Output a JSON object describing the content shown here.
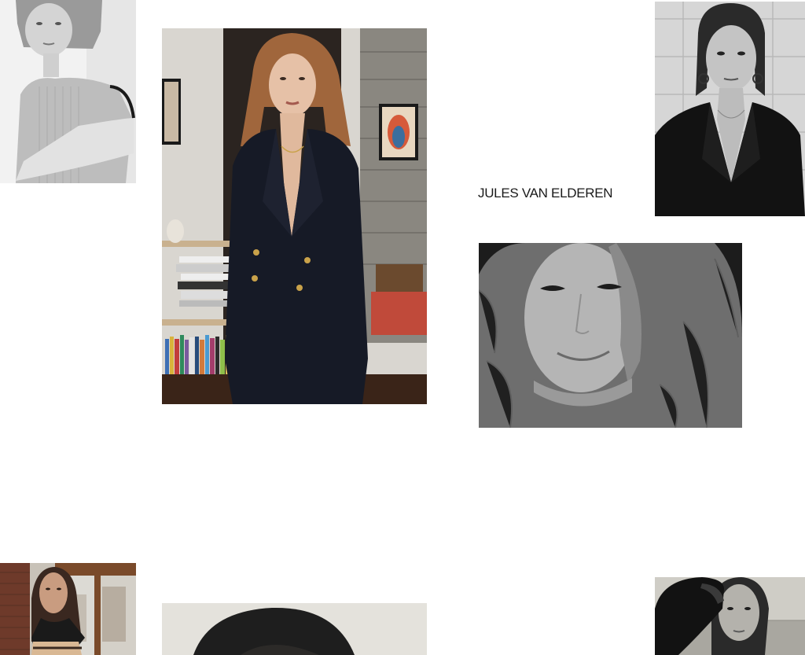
{
  "model": {
    "name": "JULES VAN ELDEREN"
  },
  "gallery": {
    "photos": [
      {
        "subject": "portrait",
        "tone": "black-and-white",
        "outfit": "sleeveless ribbed top"
      },
      {
        "subject": "full-length portrait",
        "tone": "color",
        "outfit": "navy double-breasted suit"
      },
      {
        "subject": "portrait",
        "tone": "black-and-white",
        "outfit": "dark blazer"
      },
      {
        "subject": "close-up face in hood",
        "tone": "black-and-white",
        "outfit": "knit sweater"
      },
      {
        "subject": "portrait by window",
        "tone": "color",
        "outfit": "striped top"
      },
      {
        "subject": "portrait",
        "tone": "color",
        "outfit": "dark hair close-up"
      },
      {
        "subject": "portrait at sea",
        "tone": "black-and-white",
        "outfit": "dark hat"
      }
    ]
  },
  "colors": {
    "background": "#ffffff",
    "text": "#1a1a1a"
  }
}
